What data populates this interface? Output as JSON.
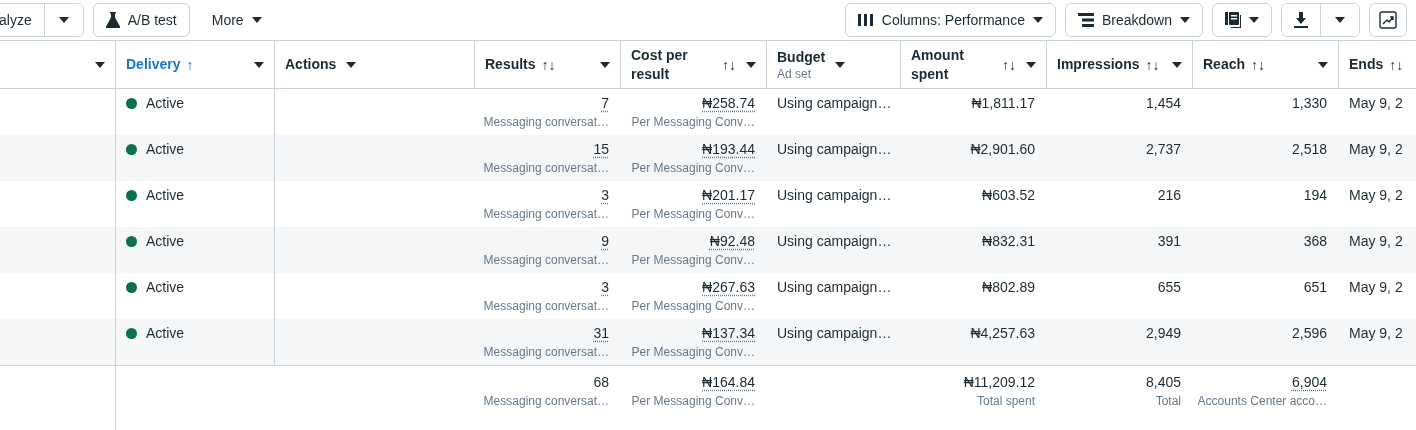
{
  "toolbar": {
    "left": [
      {
        "kind": "split",
        "label": "alyze"
      },
      {
        "kind": "button",
        "label": "A/B test"
      },
      {
        "kind": "menu",
        "label": "More"
      }
    ],
    "right": [
      {
        "kind": "menu",
        "label": "Columns: Performance"
      },
      {
        "kind": "menu",
        "label": "Breakdown"
      },
      {
        "kind": "icon_menu"
      },
      {
        "kind": "icon_split"
      },
      {
        "kind": "icon"
      }
    ]
  },
  "table": {
    "columns": [
      {},
      {
        "label": "Delivery",
        "sort_mark": "↑",
        "sorted": true
      },
      {
        "label": "Actions",
        "sorted": false
      },
      {
        "label": "Results",
        "sort_mark": "↑↓",
        "sorted": false
      },
      {
        "label": "Cost per result",
        "sort_mark": "↑↓",
        "sorted": false
      },
      {
        "label": "Budget",
        "subtitle": "Ad set",
        "sorted": false
      },
      {
        "label": "Amount spent",
        "sort_mark": "↑↓",
        "sorted": false
      },
      {
        "label": "Impressions",
        "sort_mark": "↑↓",
        "sorted": false
      },
      {
        "label": "Reach",
        "sort_mark": "↑↓",
        "sorted": false
      },
      {
        "label": "Ends",
        "sort_mark": "↑↓",
        "sorted": false
      }
    ],
    "rows": [
      {
        "status": "Active",
        "color": "#0a7150",
        "results": "7",
        "results_label": "Messaging conversat…",
        "cost": "₦258.74",
        "cost_label": "Per Messaging Conv…",
        "budget": "Using campaign…",
        "amount": "₦1,811.17",
        "impressions": "1,454",
        "reach": "1,330",
        "ends": "May 9, 2"
      },
      {
        "status": "Active",
        "color": "#0a7150",
        "results": "15",
        "results_label": "Messaging conversat…",
        "cost": "₦193.44",
        "cost_label": "Per Messaging Conv…",
        "budget": "Using campaign…",
        "amount": "₦2,901.60",
        "impressions": "2,737",
        "reach": "2,518",
        "ends": "May 9, 2"
      },
      {
        "status": "Active",
        "color": "#0a7150",
        "results": "3",
        "results_label": "Messaging conversat…",
        "cost": "₦201.17",
        "cost_label": "Per Messaging Conv…",
        "budget": "Using campaign…",
        "amount": "₦603.52",
        "impressions": "216",
        "reach": "194",
        "ends": "May 9, 2"
      },
      {
        "status": "Active",
        "color": "#0a7150",
        "results": "9",
        "results_label": "Messaging conversat…",
        "cost": "₦92.48",
        "cost_label": "Per Messaging Conv…",
        "budget": "Using campaign…",
        "amount": "₦832.31",
        "impressions": "391",
        "reach": "368",
        "ends": "May 9, 2"
      },
      {
        "status": "Active",
        "color": "#0a7150",
        "results": "3",
        "results_label": "Messaging conversat…",
        "cost": "₦267.63",
        "cost_label": "Per Messaging Conv…",
        "budget": "Using campaign…",
        "amount": "₦802.89",
        "impressions": "655",
        "reach": "651",
        "ends": "May 9, 2"
      },
      {
        "status": "Active",
        "color": "#0a7150",
        "results": "31",
        "results_label": "Messaging conversat…",
        "cost": "₦137.34",
        "cost_label": "Per Messaging Conv…",
        "budget": "Using campaign…",
        "amount": "₦4,257.63",
        "impressions": "2,949",
        "reach": "2,596",
        "ends": "May 9, 2"
      }
    ],
    "totals": {
      "results": "68",
      "results_label": "Messaging conversat…",
      "cost": "₦164.84",
      "cost_label": "Per Messaging Conv…",
      "amount": "₦11,209.12",
      "amount_label": "Total spent",
      "impressions": "8,405",
      "impressions_label": "Total",
      "reach": "6,904",
      "reach_label": "Accounts Center acco…"
    }
  }
}
